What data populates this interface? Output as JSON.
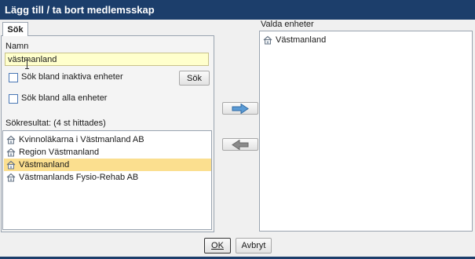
{
  "window": {
    "title": "Lägg till / ta bort medlemsskap"
  },
  "tabs": [
    {
      "label": "Sök",
      "active": true
    }
  ],
  "search": {
    "name_label": "Namn",
    "name_value": "västmanland",
    "inactive_checkbox_label": "Sök bland inaktiva enheter",
    "inactive_checked": false,
    "all_checkbox_label": "Sök bland alla enheter",
    "all_checked": false,
    "search_button_label": "Sök"
  },
  "results": {
    "header": "Sökresultat: (4 st hittades)",
    "items": [
      {
        "label": "Kvinnoläkarna i Västmanland AB",
        "icon": "house-icon",
        "selected": false
      },
      {
        "label": "Region Västmanland",
        "icon": "house-icon",
        "selected": false
      },
      {
        "label": "Västmanland",
        "icon": "house-icon",
        "selected": true
      },
      {
        "label": "Västmanlands Fysio-Rehab AB",
        "icon": "house-icon",
        "selected": false
      }
    ]
  },
  "transfer": {
    "add_icon": "arrow-right-icon",
    "remove_icon": "arrow-left-icon"
  },
  "selected_units": {
    "header": "Valda enheter",
    "items": [
      {
        "label": "Västmanland",
        "icon": "house-icon"
      }
    ]
  },
  "footer": {
    "ok_label": "OK",
    "cancel_label": "Avbryt"
  },
  "colors": {
    "titlebar": "#1c3e6b",
    "input_highlight": "#ffffcc",
    "selected_row": "#fbdf8f",
    "arrow_add": "#5b9bd5",
    "arrow_remove": "#8a8a8a"
  }
}
